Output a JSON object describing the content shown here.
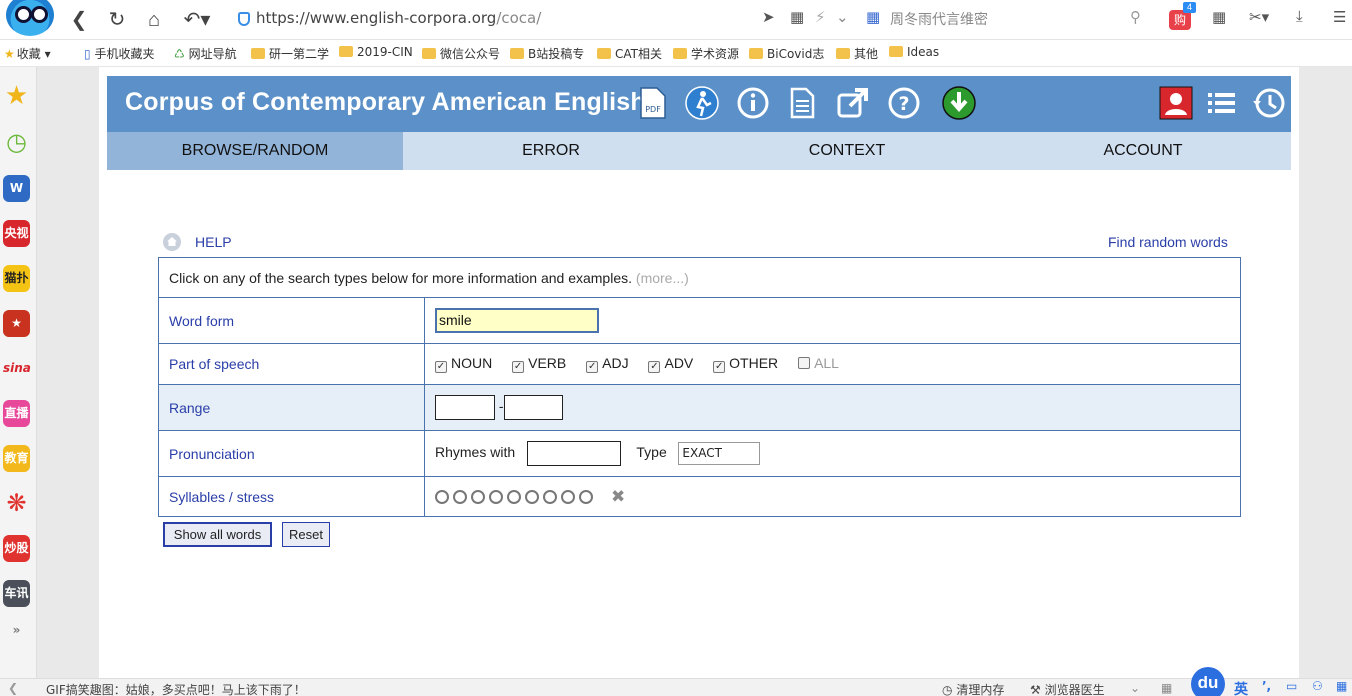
{
  "browser": {
    "url_host": "https://www.english-corpora.org",
    "url_path": "/coca/",
    "search_placeholder": "周冬雨代言维密",
    "cart_label": "购",
    "cart_badge": "4"
  },
  "bookmarks": [
    {
      "label": "收藏"
    },
    {
      "label": "手机收藏夹"
    },
    {
      "label": "网址导航"
    },
    {
      "label": "研一第二学"
    },
    {
      "label": "2019-CIN"
    },
    {
      "label": "微信公众号"
    },
    {
      "label": "B站投稿专"
    },
    {
      "label": "CAT相关"
    },
    {
      "label": "学术资源"
    },
    {
      "label": "BiCovid志"
    },
    {
      "label": "其他"
    },
    {
      "label": "Ideas"
    }
  ],
  "rail": [
    "央视",
    "猫扑",
    "sina",
    "直播",
    "教育",
    "炒股",
    "车讯"
  ],
  "site": {
    "title": "Corpus of Contemporary American English",
    "tabs": [
      "BROWSE/RANDOM",
      "ERROR",
      "CONTEXT",
      "ACCOUNT"
    ],
    "help": "HELP",
    "find_random": "Find random words",
    "intro": "Click on any of the search types below for more information and examples.",
    "more": "(more...)",
    "rows": {
      "word_form": "Word form",
      "part_of_speech": "Part of speech",
      "range": "Range",
      "pronunciation": "Pronunciation",
      "syllables": "Syllables / stress"
    },
    "word_form_value": "smile",
    "pos": [
      {
        "label": "NOUN",
        "checked": true
      },
      {
        "label": "VERB",
        "checked": true
      },
      {
        "label": "ADJ",
        "checked": true
      },
      {
        "label": "ADV",
        "checked": true
      },
      {
        "label": "OTHER",
        "checked": true
      },
      {
        "label": "ALL",
        "checked": false
      }
    ],
    "range_sep": "-",
    "rhymes_label": "Rhymes with",
    "type_label": "Type",
    "type_value": "EXACT",
    "syllable_count": 9,
    "buttons": {
      "show": "Show all words",
      "reset": "Reset"
    }
  },
  "status": {
    "left": "GIF搞笑趣图：姑娘，多买点吧！马上该下雨了！",
    "mem": "清理内存",
    "doctor": "浏览器医生",
    "ime": "英"
  }
}
